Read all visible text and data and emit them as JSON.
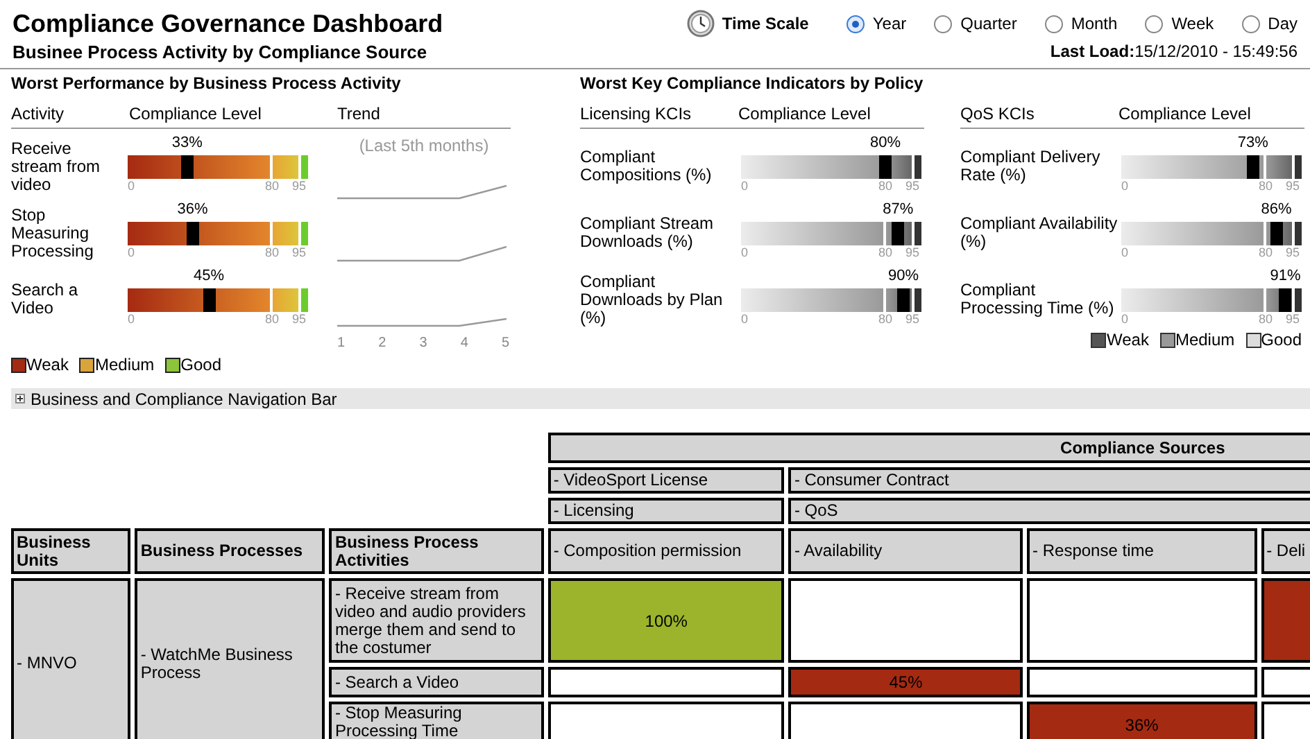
{
  "header": {
    "title": "Compliance Governance Dashboard",
    "subtitle": "Businee Process Activity by Compliance Source",
    "time_scale": {
      "label": "Time Scale",
      "options": [
        {
          "label": "Year",
          "selected": true
        },
        {
          "label": "Quarter",
          "selected": false
        },
        {
          "label": "Month",
          "selected": false
        },
        {
          "label": "Week",
          "selected": false
        },
        {
          "label": "Day",
          "selected": false
        }
      ]
    },
    "last_load": {
      "label": "Last Load:",
      "value": "15/12/2010 - 15:49:56"
    }
  },
  "activity_panel": {
    "title": "Worst Performance by Business Process Activity",
    "columns": [
      "Activity",
      "Compliance Level",
      "Trend"
    ],
    "trend_note": "(Last 5th months)",
    "trend_axis": [
      "1",
      "2",
      "3",
      "4",
      "5"
    ],
    "rows": [
      {
        "name": "Receive stream from video",
        "reading": "33%",
        "level": 0.33,
        "scale": [
          "0",
          "80",
          "95"
        ]
      },
      {
        "name": "Stop Measuring Processing",
        "reading": "36%",
        "level": 0.36,
        "scale": [
          "0",
          "80",
          "95"
        ]
      },
      {
        "name": "Search a Video",
        "reading": "45%",
        "level": 0.45,
        "scale": [
          "0",
          "80",
          "95"
        ]
      }
    ],
    "legend": [
      {
        "label": "Weak",
        "color": "#a52a12"
      },
      {
        "label": "Medium",
        "color": "#d9a43c"
      },
      {
        "label": "Good",
        "color": "#8cc43a"
      }
    ]
  },
  "kci_panel": {
    "title": "Worst Key Compliance Indicators by Policy",
    "groups": [
      {
        "columns": [
          "Licensing KCIs",
          "Compliance Level"
        ],
        "rows": [
          {
            "name": "Compliant Compositions (%)",
            "reading": "80%",
            "level": 0.8,
            "scale": [
              "0",
              "80",
              "95"
            ]
          },
          {
            "name": "Compliant Stream Downloads (%)",
            "reading": "87%",
            "level": 0.87,
            "scale": [
              "0",
              "80",
              "95"
            ]
          },
          {
            "name": "Compliant Downloads by Plan (%)",
            "reading": "90%",
            "level": 0.9,
            "scale": [
              "0",
              "80",
              "95"
            ]
          }
        ]
      },
      {
        "columns": [
          "QoS KCIs",
          "Compliance Level"
        ],
        "rows": [
          {
            "name": "Compliant Delivery Rate (%)",
            "reading": "73%",
            "level": 0.73,
            "scale": [
              "0",
              "80",
              "95"
            ]
          },
          {
            "name": "Compliant Availability (%)",
            "reading": "86%",
            "level": 0.86,
            "scale": [
              "0",
              "80",
              "95"
            ]
          },
          {
            "name": "Compliant Processing Time (%)",
            "reading": "91%",
            "level": 0.91,
            "scale": [
              "0",
              "80",
              "95"
            ]
          }
        ]
      }
    ],
    "legend": [
      {
        "label": "Weak",
        "color": "#555555"
      },
      {
        "label": "Medium",
        "color": "#999999"
      },
      {
        "label": "Good",
        "color": "#dddddd"
      }
    ]
  },
  "nav_bar": {
    "label": "Business and Compliance Navigation Bar",
    "expanded": false
  },
  "matrix": {
    "title": "Compliance Sources",
    "columns": [
      "Business Units",
      "Business Processes",
      "Business Process Activities"
    ],
    "sources": [
      {
        "label": "- VideoSport License",
        "policies": [
          {
            "label": "- Licensing",
            "kcis": [
              "- Composition permission"
            ]
          }
        ]
      },
      {
        "label": "- Consumer Contract",
        "policies": [
          {
            "label": "- QoS",
            "kcis": [
              "- Availability",
              "- Response time",
              "- Deli"
            ]
          }
        ]
      }
    ],
    "units": [
      {
        "name": "- MNVO",
        "processes": [
          {
            "name": "- WatchMe Business Process",
            "activities": [
              {
                "name": "- Receive stream from video and audio providers merge them and send to the costumer",
                "cells": [
                  {
                    "kind": "good",
                    "text": "100%"
                  },
                  {
                    "kind": "empty"
                  },
                  {
                    "kind": "empty"
                  },
                  {
                    "kind": "weak"
                  }
                ]
              },
              {
                "name": "- Search a Video",
                "cells": [
                  {
                    "kind": "empty"
                  },
                  {
                    "kind": "weak",
                    "text": "45%"
                  },
                  {
                    "kind": "empty"
                  },
                  {
                    "kind": "empty"
                  }
                ]
              },
              {
                "name": "- Stop Measuring Processing Time",
                "cells": [
                  {
                    "kind": "empty"
                  },
                  {
                    "kind": "empty"
                  },
                  {
                    "kind": "weak",
                    "text": "36%"
                  },
                  {
                    "kind": "empty"
                  }
                ]
              }
            ]
          }
        ]
      }
    ]
  }
}
